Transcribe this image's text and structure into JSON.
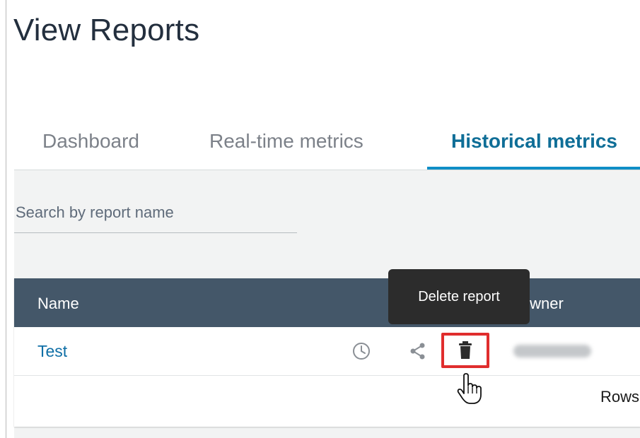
{
  "page": {
    "title": "View Reports"
  },
  "tabs": [
    {
      "label": "Dashboard",
      "active": false
    },
    {
      "label": "Real-time metrics",
      "active": false
    },
    {
      "label": "Historical metrics",
      "active": true
    }
  ],
  "search": {
    "placeholder": "Search by report name",
    "value": ""
  },
  "table": {
    "columns": [
      "Name",
      "Owner"
    ],
    "rows": [
      {
        "name": "Test",
        "actions": [
          "clock-icon",
          "share-icon",
          "trash-icon"
        ]
      }
    ],
    "pagination": {
      "label": "Rows"
    }
  },
  "tooltip": {
    "text": "Delete report"
  },
  "colors": {
    "accent": "#0f8ec6",
    "header_bg": "#445769",
    "link": "#0f6fa6",
    "highlight": "#e02d2d"
  }
}
